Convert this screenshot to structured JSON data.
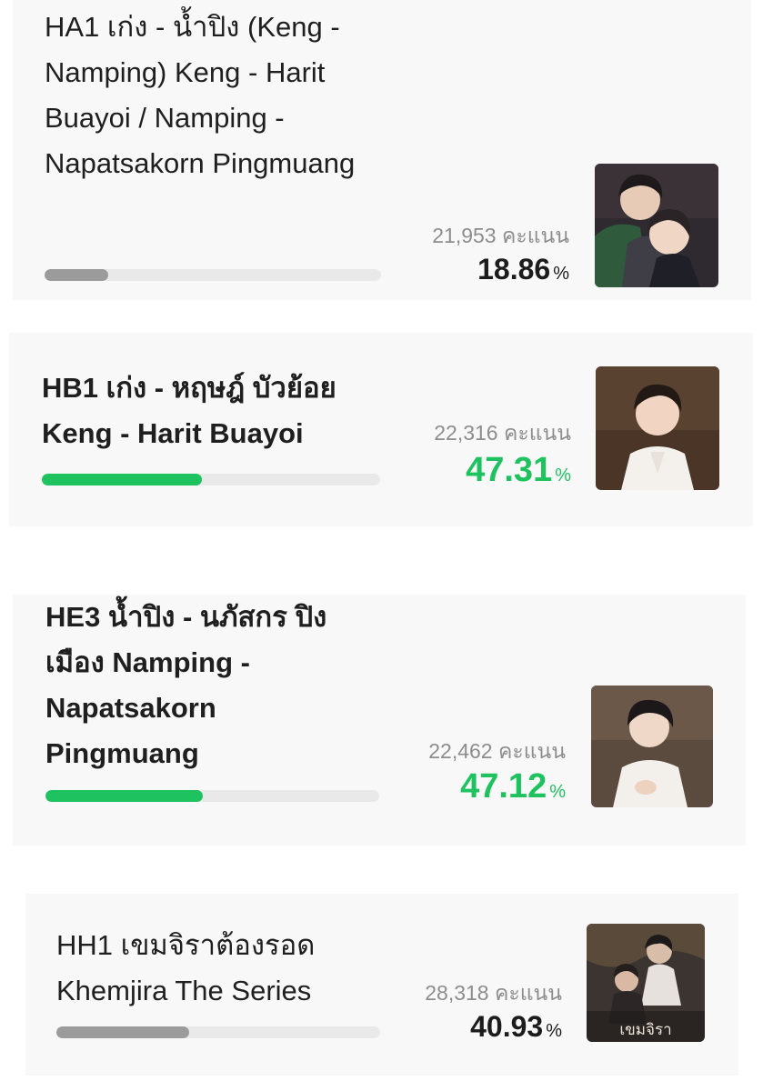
{
  "entries": [
    {
      "title": "HA1 เก่ง - น้ำปิง (Keng - Namping) Keng - Harit Buayoi / Namping - Napatsakorn Pingmuang",
      "votes": "21,953 คะแนน",
      "percent": "18.86",
      "percent_symbol": "%",
      "progress": 0.1886,
      "bar_color": "#9b9b9b",
      "image": "couple-photo"
    },
    {
      "title": "HB1 เก่ง - หฤษฎ์ บัวย้อย Keng - Harit Buayoi",
      "votes": "22,316 คะแนน",
      "percent": "47.31",
      "percent_symbol": "%",
      "progress": 0.4731,
      "bar_color": "#1ec25f",
      "image": "portrait-photo-keng"
    },
    {
      "title": "HE3 น้ำปิง - นภัสกร ปิงเมือง Namping - Napatsakorn Pingmuang",
      "votes": "22,462 คะแนน",
      "percent": "47.12",
      "percent_symbol": "%",
      "progress": 0.4712,
      "bar_color": "#1ec25f",
      "image": "portrait-photo-namping"
    },
    {
      "title": "HH1 เขมจิราต้องรอด Khemjira The Series",
      "votes": "28,318 คะแนน",
      "percent": "40.93",
      "percent_symbol": "%",
      "progress": 0.4093,
      "bar_color": "#9b9b9b",
      "image": "series-poster",
      "poster_text": "เขมจิรา"
    }
  ]
}
